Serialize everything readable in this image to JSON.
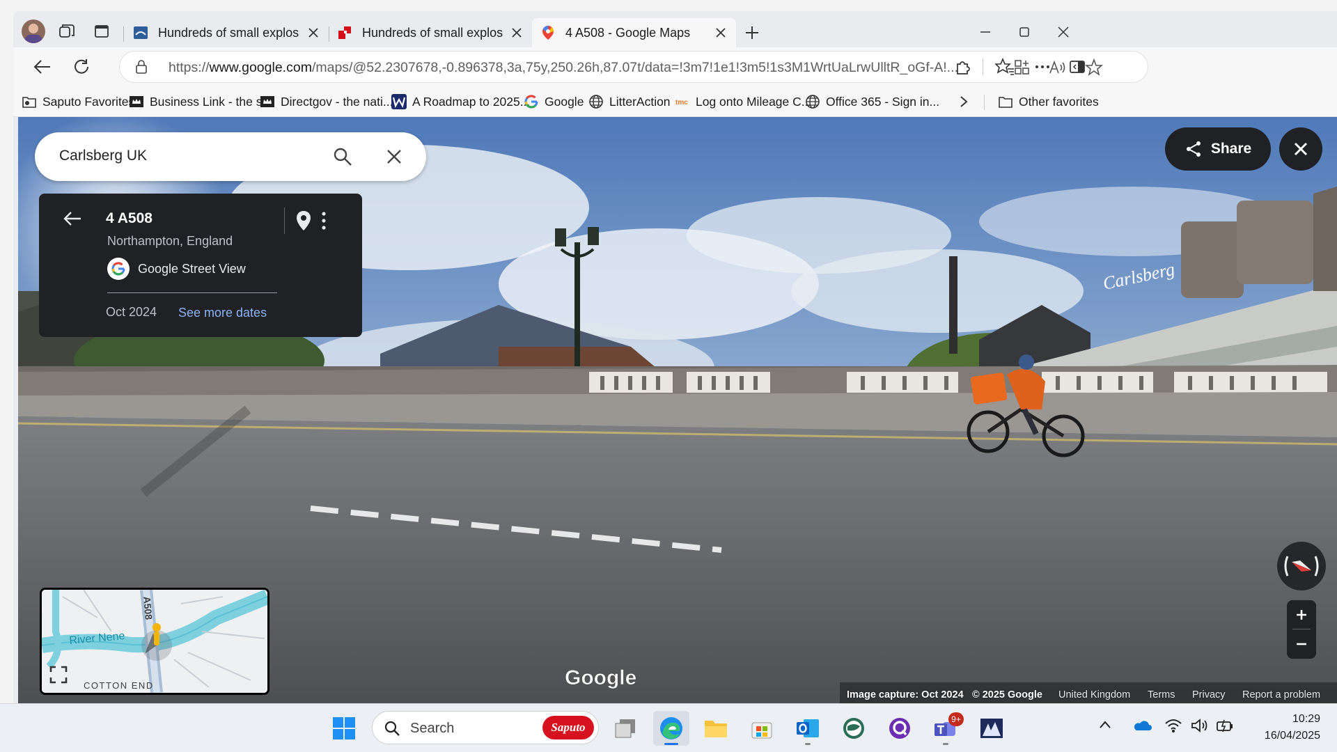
{
  "browser": {
    "tabs": [
      {
        "title": "Hundreds of small explosives reco",
        "active": false
      },
      {
        "title": "Hundreds of small explosives reco",
        "active": false
      },
      {
        "title": "4 A508 - Google Maps",
        "active": true
      }
    ],
    "url_prefix": "https://",
    "url_host": "www.google.com",
    "url_rest": "/maps/@52.2307678,-0.896378,3a,75y,250.26h,87.07t/data=!3m7!1e1!3m5!1s3M1WrtUaLrwUlltR_oGf-A!...",
    "favorites": [
      {
        "label": "Saputo Favorites",
        "icon": "folder-icon"
      },
      {
        "label": "Business Link - the s...",
        "icon": "crown-icon"
      },
      {
        "label": "Directgov - the nati...",
        "icon": "crown-icon"
      },
      {
        "label": "A Roadmap to 2025...",
        "icon": "w-icon"
      },
      {
        "label": "Google",
        "icon": "google-icon"
      },
      {
        "label": "LitterAction",
        "icon": "globe-icon"
      },
      {
        "label": "Log onto Mileage C...",
        "icon": "tmc-icon"
      },
      {
        "label": "Office 365 - Sign in...",
        "icon": "globe-icon"
      }
    ],
    "other_favorites": "Other favorites"
  },
  "maps": {
    "search_value": "Carlsberg UK",
    "place_title": "4 A508",
    "place_subtitle": "Northampton, England",
    "source": "Google Street View",
    "capture_date": "Oct 2024",
    "see_more_dates": "See more dates",
    "share_label": "Share",
    "watermark": "Google",
    "minimap": {
      "road_label": "A508",
      "river_label": "River Nene",
      "area_label": "COTTON END"
    },
    "footer": {
      "capture": "Image capture: Oct 2024",
      "copyright": "© 2025 Google",
      "region": "United Kingdom",
      "terms": "Terms",
      "privacy": "Privacy",
      "report": "Report a problem"
    },
    "street_signs": {
      "brand": "Carlsberg"
    }
  },
  "taskbar": {
    "search_placeholder": "Search",
    "search_badge": "Saputo",
    "teams_badge": "9+",
    "time": "10:29",
    "date": "16/04/2025"
  },
  "colors": {
    "accent_blue": "#8ab4f8",
    "dark_panel": "#202124",
    "edge_active_tab": "#f7f7f7"
  }
}
